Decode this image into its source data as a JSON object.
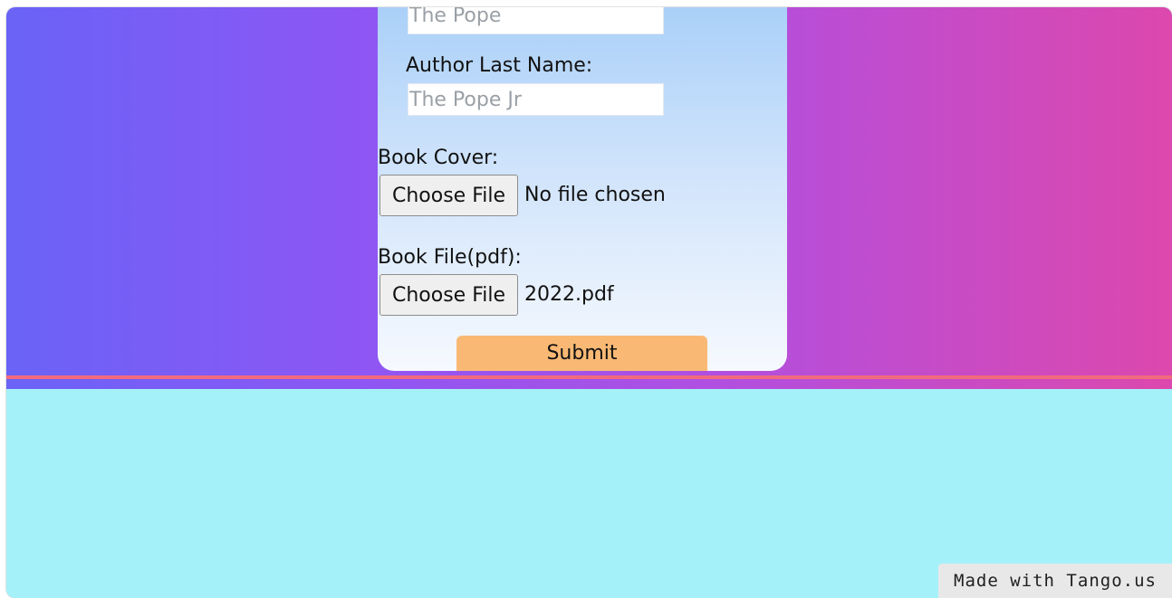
{
  "form": {
    "author_first_name": {
      "value": "",
      "placeholder": "The Pope"
    },
    "author_last_name": {
      "label": "Author Last Name:",
      "value": "",
      "placeholder": "The Pope Jr"
    },
    "book_cover": {
      "label": "Book Cover:",
      "button_label": "Choose File",
      "status": "No file chosen"
    },
    "book_file": {
      "label": "Book File(pdf):",
      "button_label": "Choose File",
      "status": "2022.pdf"
    },
    "submit_label": "Submit"
  },
  "watermark": {
    "text": "Made with Tango.us"
  },
  "colors": {
    "gradient_start": "#6a63f6",
    "gradient_end": "#dc48ad",
    "accent_line": "#f26a7e",
    "lower_background": "#a5f1f9",
    "submit_button": "#f9b975"
  }
}
